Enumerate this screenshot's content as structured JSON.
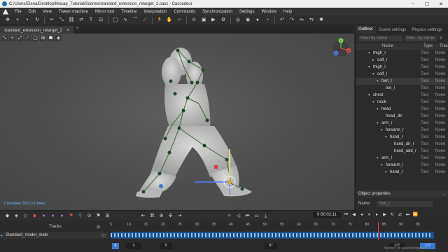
{
  "window": {
    "title": "C:/Users/Elena/Desktop/Mocap_Tutorial/Scenes/standard_extension_retarget_2.casc - Cascadeur"
  },
  "menu": [
    "File",
    "Edit",
    "View",
    "Tween machine",
    "Mirror tool",
    "Timeline",
    "Interpolation",
    "Commands",
    "Synchronization",
    "Settings",
    "Window",
    "Help"
  ],
  "scene_tab": {
    "label": "standard_extension_retarget_2",
    "close": "×",
    "add": "+"
  },
  "viewport": {
    "version": "Cascadeur 2022.3.1 Basic",
    "gizmo_axes": [
      "Y",
      "X",
      "Z"
    ]
  },
  "right_panel": {
    "tabs": [
      "Outliner",
      "Scene settings",
      "Physics settings"
    ],
    "filter_placeholder": "Filter by name",
    "filter2_placeholder": "Filte...by name",
    "columns": {
      "name": "Name",
      "type": "Type",
      "track": "Track"
    },
    "rows": [
      {
        "name": "thigh_r",
        "indent": 1,
        "arrow": "down",
        "type": "Tool",
        "track": "None"
      },
      {
        "name": "calf_r",
        "indent": 2,
        "arrow": "right",
        "type": "Tool",
        "track": "None"
      },
      {
        "name": "thigh_l",
        "indent": 1,
        "arrow": "down",
        "type": "Tool",
        "track": "None"
      },
      {
        "name": "calf_l",
        "indent": 2,
        "arrow": "down",
        "type": "Tool",
        "track": "None"
      },
      {
        "name": "foot_l",
        "indent": 3,
        "arrow": "down",
        "type": "Tool",
        "track": "None",
        "selected": true
      },
      {
        "name": "toe_l",
        "indent": 4,
        "arrow": "",
        "type": "Tool",
        "track": "None"
      },
      {
        "name": "chest",
        "indent": 1,
        "arrow": "down",
        "type": "Tool",
        "track": "None"
      },
      {
        "name": "neck",
        "indent": 2,
        "arrow": "down",
        "type": "Tool",
        "track": "None"
      },
      {
        "name": "head",
        "indent": 3,
        "arrow": "down",
        "type": "Tool",
        "track": "None"
      },
      {
        "name": "head_dir",
        "indent": 4,
        "arrow": "",
        "type": "Tool",
        "track": "None"
      },
      {
        "name": "arm_r",
        "indent": 3,
        "arrow": "down",
        "type": "Tool",
        "track": "None"
      },
      {
        "name": "forearm_r",
        "indent": 4,
        "arrow": "down",
        "type": "Tool",
        "track": "None"
      },
      {
        "name": "hand_r",
        "indent": 5,
        "arrow": "down",
        "type": "Tool",
        "track": "None"
      },
      {
        "name": "hand_dir_r",
        "indent": 6,
        "arrow": "",
        "type": "Tool",
        "track": "None"
      },
      {
        "name": "hand_add_r",
        "indent": 6,
        "arrow": "",
        "type": "Tool",
        "track": "None"
      },
      {
        "name": "arm_l",
        "indent": 3,
        "arrow": "down",
        "type": "Tool",
        "track": "None"
      },
      {
        "name": "forearm_l",
        "indent": 4,
        "arrow": "down",
        "type": "Tool",
        "track": "None"
      },
      {
        "name": "hand_l",
        "indent": 5,
        "arrow": "down",
        "type": "Tool",
        "track": "None"
      }
    ],
    "object_properties": {
      "title": "Object properties",
      "name_label": "Name",
      "name_value": "foot_l"
    }
  },
  "transport": {
    "timecode": "0:00:02:11"
  },
  "timeline": {
    "tracks_label": "Tracks",
    "track_name": "Standard_model_male",
    "ruler": [
      "5",
      "10",
      "15",
      "20",
      "25",
      "30",
      "35",
      "40",
      "45",
      "50",
      "55",
      "60",
      "65",
      "70",
      "75",
      "80",
      "85",
      "90",
      "95"
    ],
    "fields": {
      "start": "0",
      "range_start": "5",
      "current": "87",
      "end": "177",
      "end2": "177"
    },
    "playhead_frame": 70
  },
  "status": {
    "text": "Number of selected objects: 1"
  },
  "colors": {
    "accent": "#1e4f86",
    "keyframe": "#8ec2ff",
    "playhead": "#e04040",
    "viewport": "#4e4e4e"
  }
}
